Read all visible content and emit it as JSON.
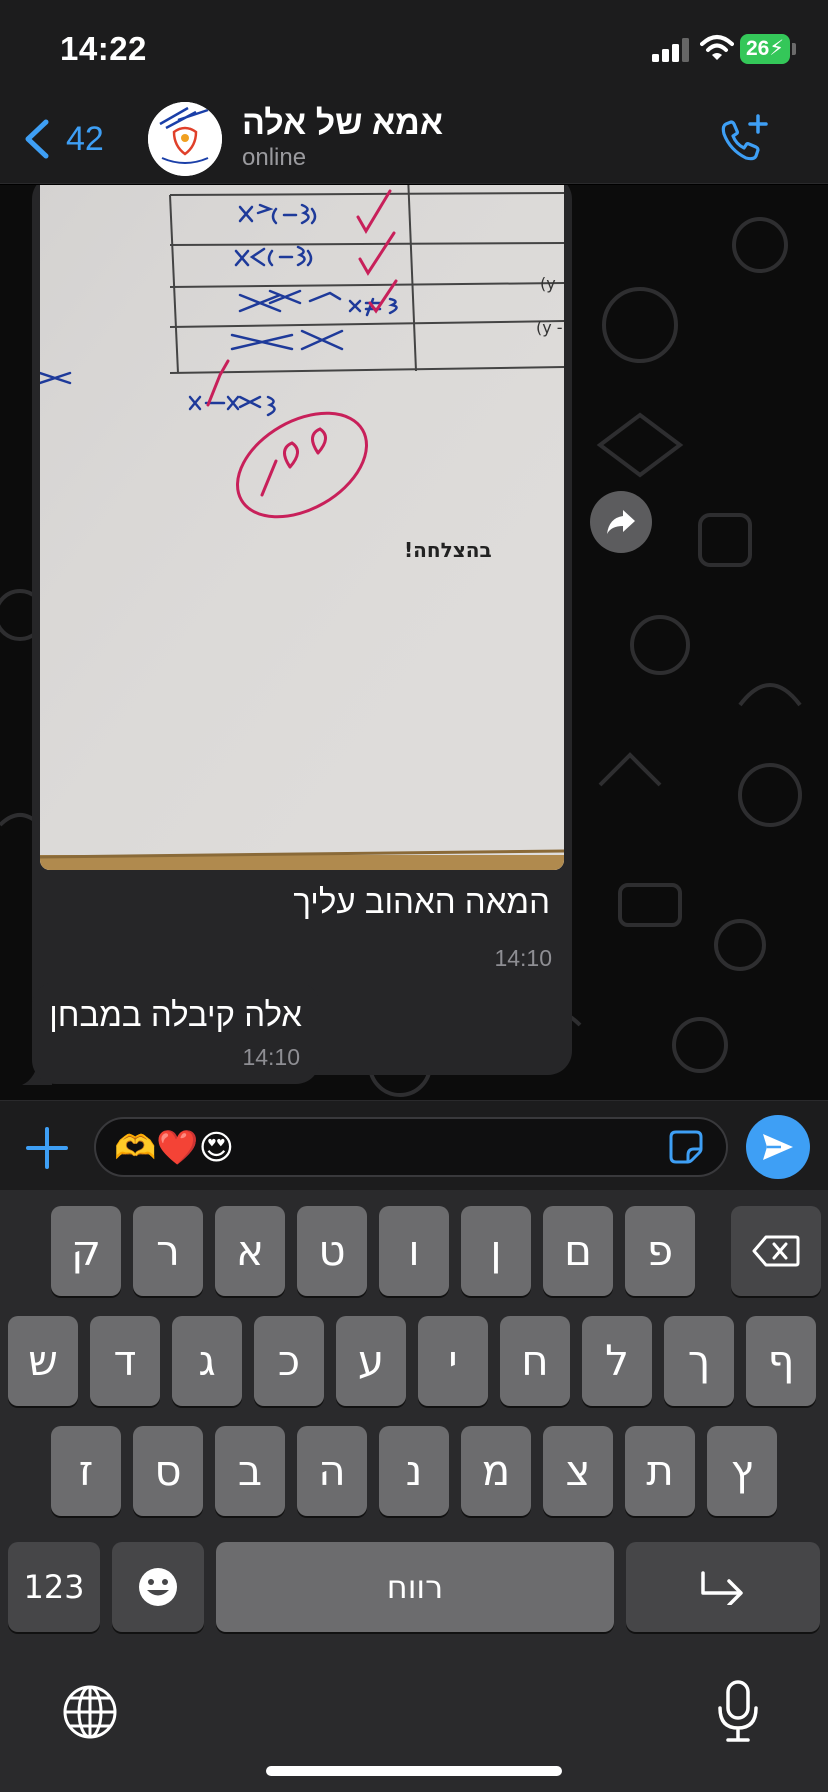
{
  "status_bar": {
    "time": "14:22",
    "battery": "26"
  },
  "header": {
    "back_count": "42",
    "title": "אמא של אלה",
    "status": "online"
  },
  "messages": [
    {
      "type": "image",
      "photo_text": "בהצלחה!",
      "score": "100",
      "caption": "המאה האהוב עליך",
      "time": "14:10"
    },
    {
      "type": "text",
      "text": "אלה קיבלה במבחן",
      "time": "14:10"
    }
  ],
  "input": {
    "value": "🫶❤️😍"
  },
  "keyboard": {
    "row1": [
      "ק",
      "ר",
      "א",
      "ט",
      "ו",
      "ן",
      "ם",
      "פ"
    ],
    "row2": [
      "ש",
      "ד",
      "ג",
      "כ",
      "ע",
      "י",
      "ח",
      "ל",
      "ך",
      "ף"
    ],
    "row3": [
      "ז",
      "ס",
      "ב",
      "ה",
      "נ",
      "מ",
      "צ",
      "ת",
      "ץ"
    ],
    "numbers_key": "123",
    "space_key": "רווח"
  },
  "colors": {
    "accent": "#3e9ff5",
    "battery": "#34c759",
    "bubble": "#262628"
  },
  "icons": [
    "signal-icon",
    "wifi-icon",
    "back-chevron-icon",
    "add-call-icon",
    "forward-icon",
    "plus-icon",
    "sticker-icon",
    "send-icon",
    "backspace-icon",
    "emoji-icon",
    "return-icon",
    "globe-icon",
    "mic-icon"
  ]
}
